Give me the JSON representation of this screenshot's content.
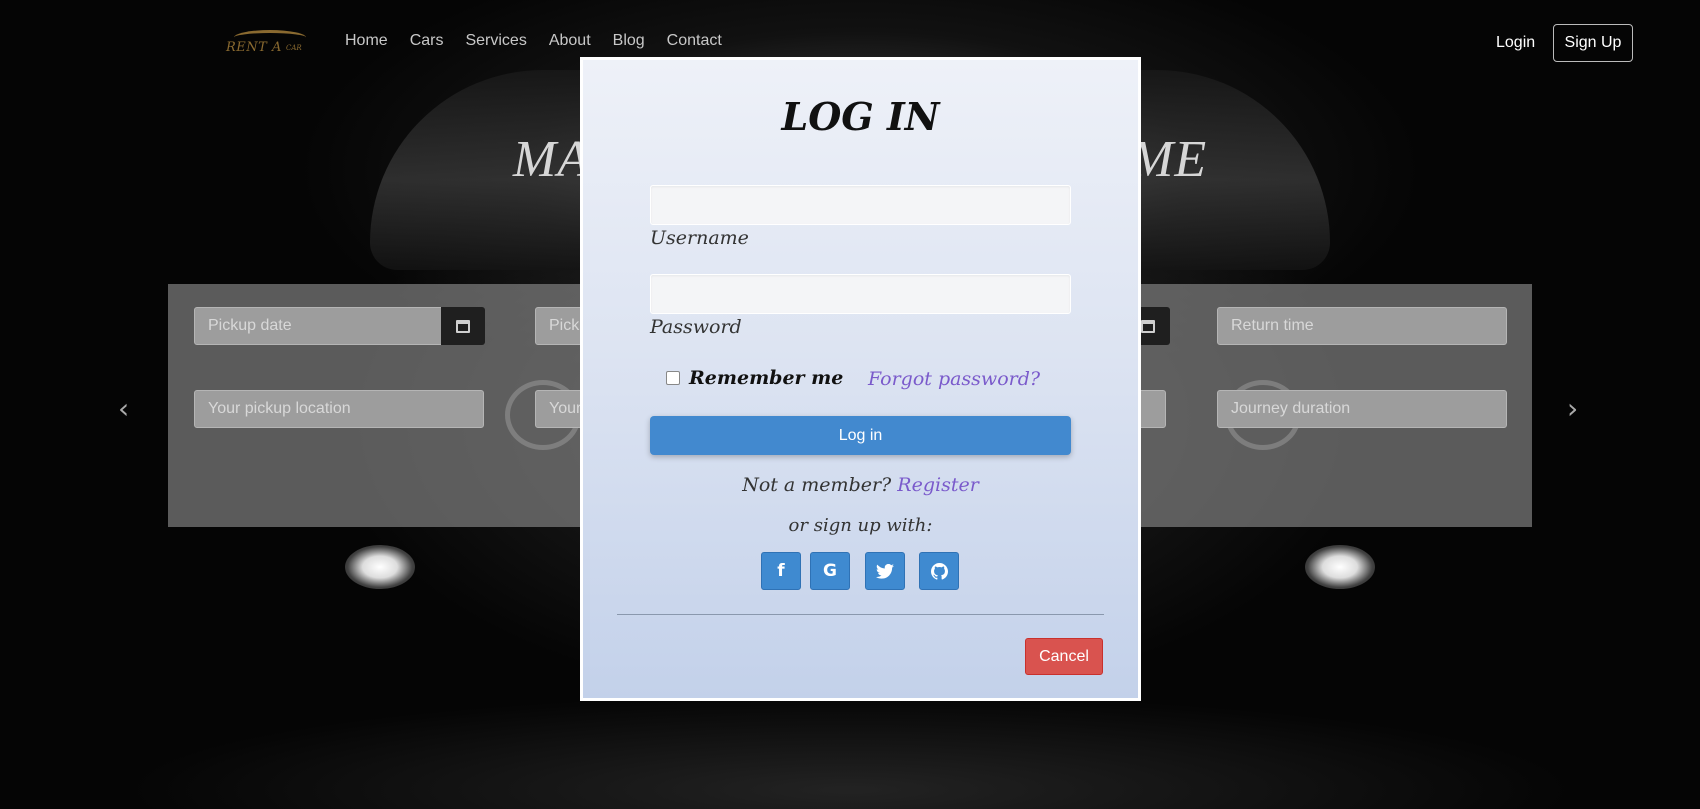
{
  "navbar": {
    "logo_main": "RENT A",
    "logo_small": "CAR",
    "links": [
      "Home",
      "Cars",
      "Services",
      "About",
      "Blog",
      "Contact"
    ],
    "login": "Login",
    "signup": "Sign Up"
  },
  "hero": {
    "title_left": "MA",
    "title_right": "ME"
  },
  "search": {
    "pickup_date": "Pickup date",
    "pickup_time_partial": "Pick",
    "return_time": "Return time",
    "pickup_location": "Your pickup location",
    "return_location_partial": "Your",
    "journey_duration": "Journey duration",
    "calendar_icon": "calendar-icon",
    "prev_arrow": "‹",
    "next_arrow": "›"
  },
  "modal": {
    "title": "LOG IN",
    "username_label": "Username",
    "password_label": "Password",
    "remember_label": "Remember me",
    "remember_checked": false,
    "forgot_link": "Forgot password?",
    "login_button": "Log in",
    "not_member_text": "Not a member?",
    "register_link": "Register",
    "or_signup_text": "or sign up with:",
    "social": [
      {
        "icon": "facebook-icon",
        "glyph": "f"
      },
      {
        "icon": "google-icon",
        "glyph": "G"
      },
      {
        "icon": "twitter-icon",
        "glyph": "🐦"
      },
      {
        "icon": "github-icon",
        "glyph": "⌾"
      }
    ],
    "cancel_button": "Cancel"
  },
  "colors": {
    "primary_button": "#4289cf",
    "cancel_button": "#d9534f",
    "link": "#7a5acb"
  }
}
